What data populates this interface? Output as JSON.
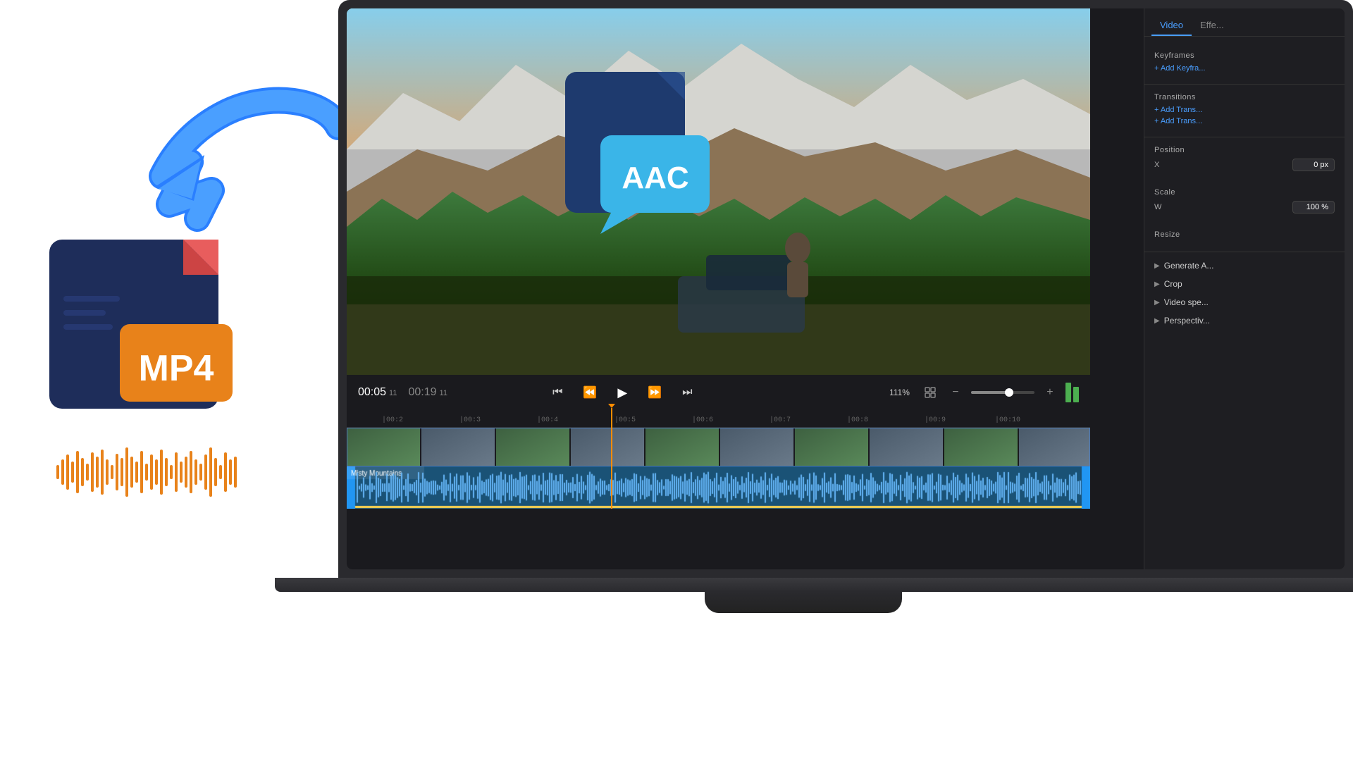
{
  "left": {
    "mp4_label": "MP4",
    "aac_label": "AAC"
  },
  "panel": {
    "tab_video": "Video",
    "tab_effects": "Effe...",
    "keyframes_label": "Keyframes",
    "add_keyframe": "+ Add Keyfra...",
    "transitions_label": "Transitions",
    "add_transition_1": "+ Add Trans...",
    "add_transition_2": "+ Add Trans...",
    "position_label": "Position",
    "position_x_label": "X",
    "position_x_value": "0 px",
    "scale_label": "Scale",
    "scale_w_label": "W",
    "scale_w_value": "100 %",
    "resize_label": "Resize",
    "generate_ai_label": "Generate A...",
    "crop_label": "Crop",
    "video_spec_label": "Video spe...",
    "perspective_label": "Perspectiv..."
  },
  "playback": {
    "current_time": "00:05",
    "current_frame": "11",
    "total_time": "00:19",
    "total_frame": "11",
    "zoom_level": "111%"
  },
  "timeline": {
    "ruler_marks": [
      "00:2",
      "00:3",
      "00:4",
      "00:5",
      "00:6",
      "00:7",
      "00:8",
      "00:9",
      "00:10"
    ],
    "audio_track_name": "Misty Mountains"
  }
}
